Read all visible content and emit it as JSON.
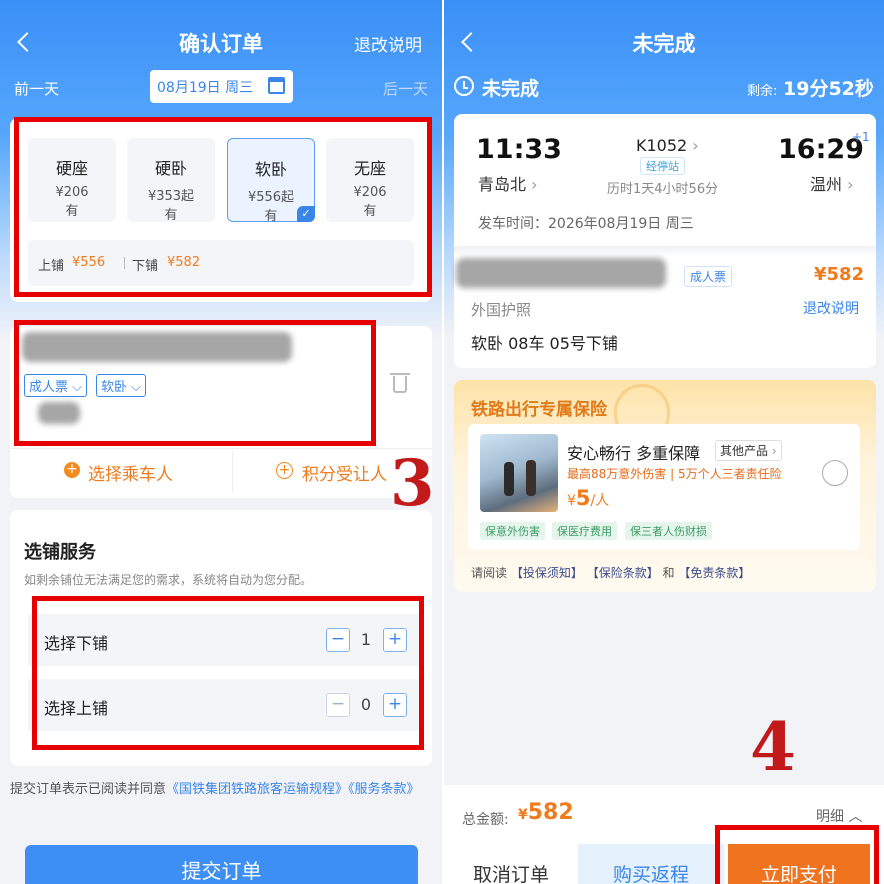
{
  "left": {
    "header": {
      "title": "确认订单",
      "refund_link": "退改说明"
    },
    "date_nav": {
      "prev": "前一天",
      "date": "08月19日 周三",
      "next": "后一天"
    },
    "seats": [
      {
        "name": "硬座",
        "price": "¥206",
        "avail": "有"
      },
      {
        "name": "硬卧",
        "price": "¥353起",
        "avail": "有"
      },
      {
        "name": "软卧",
        "price": "¥556起",
        "avail": "有",
        "selected": true
      },
      {
        "name": "无座",
        "price": "¥206",
        "avail": "有"
      }
    ],
    "berth_prices": {
      "upper_label": "上铺",
      "upper_price": "¥556",
      "lower_label": "下铺",
      "lower_price": "¥582"
    },
    "passenger": {
      "ticket_type": "成人票",
      "seat_type": "软卧"
    },
    "actions": {
      "select_passenger": "选择乘车人",
      "points_transfer": "积分受让人"
    },
    "annotation_number": "3",
    "berth_service": {
      "title": "选铺服务",
      "desc": "如剩余铺位无法满足您的需求，系统将自动为您分配。",
      "rows": [
        {
          "label": "选择下铺",
          "count": "1"
        },
        {
          "label": "选择上铺",
          "count": "0"
        }
      ]
    },
    "agreement": {
      "prefix": "提交订单表示已阅读并同意",
      "link1": "《国铁集团铁路旅客运输规程》",
      "link2": "《服务条款》"
    },
    "submit": "提交订单"
  },
  "right": {
    "header": {
      "title": "未完成"
    },
    "status": {
      "label": "未完成",
      "remaining_label": "剩余:",
      "remaining_time": "19分52秒"
    },
    "trip": {
      "dep_time": "11:33",
      "dep_station": "青岛北",
      "train": "K1052",
      "stop_tag": "经停站",
      "duration": "历时1天4小时56分",
      "arr_time": "16:29",
      "arr_station": "温州",
      "day_offset": "+1",
      "departure_date_label": "发车时间：2026年08月19日 周三"
    },
    "passenger": {
      "ticket_type": "成人票",
      "price": "¥582",
      "id_type": "外国护照",
      "refund_link": "退改说明",
      "seat_info": "软卧 08车 05号下铺"
    },
    "insurance": {
      "title": "铁路出行专属保险",
      "product": "安心畅行 多重保障",
      "other": "其他产品",
      "desc": "最高88万意外伤害 | 5万个人三者责任险",
      "price_symbol": "¥",
      "price": "5",
      "unit": "/人",
      "tags": [
        "保意外伤害",
        "保医疗费用",
        "保三者人伤财损"
      ],
      "notice": {
        "prefix": "请阅读",
        "link1": "【投保须知】",
        "link2": "【保险条款】",
        "and": "和",
        "link3": "【免责条款】"
      }
    },
    "annotation_number": "4",
    "footer": {
      "total_label": "总金额:",
      "total_symbol": "¥",
      "total": "582",
      "detail": "明细",
      "cancel": "取消订单",
      "return_trip": "购买返程",
      "pay": "立即支付"
    }
  },
  "colors": {
    "accent": "#3a86e8",
    "price": "#f07b1d",
    "annotation": "#e60000",
    "pay": "#f0741f"
  }
}
